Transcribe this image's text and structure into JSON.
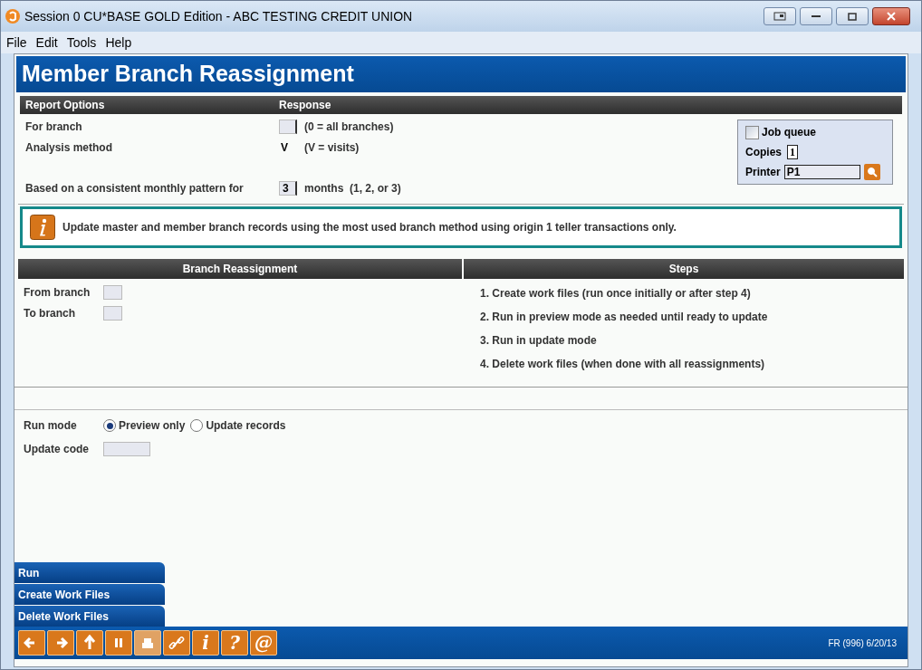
{
  "window": {
    "title": "Session 0 CU*BASE GOLD Edition - ABC TESTING CREDIT UNION"
  },
  "menu": [
    "File",
    "Edit",
    "Tools",
    "Help"
  ],
  "page_title": "Member Branch Reassignment",
  "report_options": {
    "columns": [
      "Report Options",
      "Response"
    ],
    "rows": [
      {
        "label": "For branch",
        "kind": "field",
        "hint": "(0 = all branches)"
      },
      {
        "label": "Analysis method",
        "kind": "text",
        "value": "V",
        "hint": "(V = visits)"
      },
      {
        "label": "Based on a consistent monthly pattern for",
        "kind": "field",
        "value": "3",
        "hint": "months  (1, 2, or 3)"
      }
    ]
  },
  "print_options": {
    "job_queue": {
      "label": "Job queue",
      "checked": false
    },
    "copies": {
      "label": "Copies",
      "value": "1"
    },
    "printer": {
      "label": "Printer",
      "value": "P1"
    }
  },
  "info": "Update master and member branch records using the most used branch method using origin 1 teller transactions only.",
  "branch_reassignment": {
    "title": "Branch Reassignment",
    "fields": [
      {
        "label": "From branch"
      },
      {
        "label": "To branch"
      }
    ]
  },
  "steps": {
    "title": "Steps",
    "items": [
      "1. Create work files (run once initially or after step 4)",
      "2. Run in preview mode as needed until ready to update",
      "3. Run in update mode",
      "4. Delete work files (when done with all reassignments)"
    ]
  },
  "run_mode": {
    "label": "Run mode",
    "options": [
      {
        "label": "Preview only",
        "selected": true
      },
      {
        "label": "Update records",
        "selected": false
      }
    ]
  },
  "update_code": {
    "label": "Update code"
  },
  "actions": [
    "Run",
    "Create Work Files",
    "Delete Work Files"
  ],
  "toolbar": [
    {
      "kind": "back",
      "disabled": false
    },
    {
      "kind": "forward",
      "disabled": false
    },
    {
      "kind": "up",
      "disabled": false
    },
    {
      "kind": "pause",
      "disabled": false
    },
    {
      "kind": "print",
      "disabled": true
    },
    {
      "kind": "link",
      "disabled": false
    },
    {
      "kind": "glyph",
      "label": "i",
      "disabled": false
    },
    {
      "kind": "glyph",
      "label": "?",
      "disabled": false
    },
    {
      "kind": "glyph",
      "label": "@",
      "disabled": false
    }
  ],
  "status": "FR (996) 6/20/13"
}
